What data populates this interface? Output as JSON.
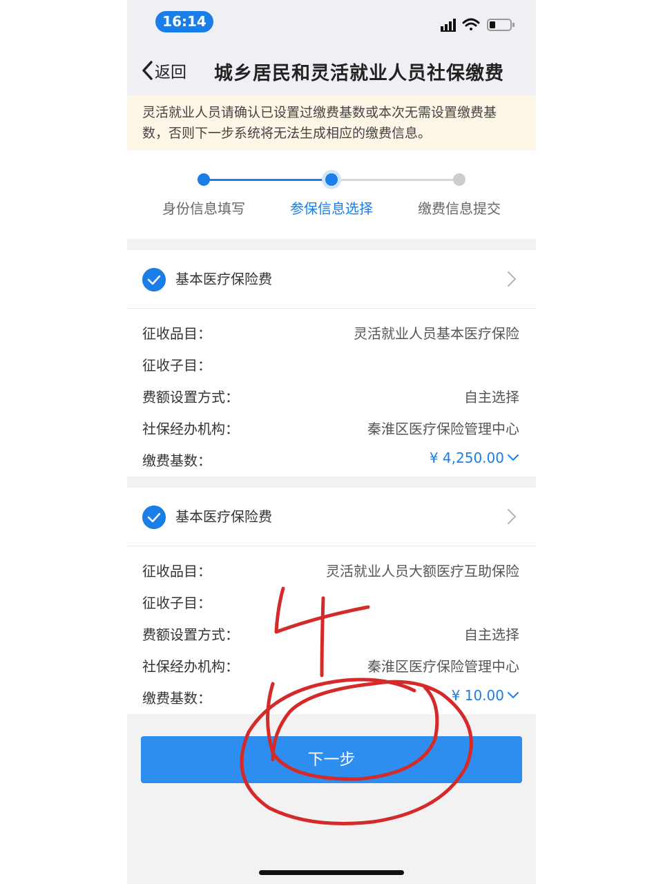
{
  "status_bar": {
    "time": "16:14"
  },
  "nav": {
    "back_label": "返回",
    "title": "城乡居民和灵活就业人员社保缴费"
  },
  "notice": {
    "text": "灵活就业人员请确认已设置过缴费基数或本次无需设置缴费基数，否则下一步系统将无法生成相应的缴费信息。"
  },
  "steps": [
    {
      "label": "身份信息填写",
      "state": "done"
    },
    {
      "label": "参保信息选择",
      "state": "active"
    },
    {
      "label": "缴费信息提交",
      "state": "pending"
    }
  ],
  "cards": [
    {
      "title": "基本医疗保险费",
      "rows": [
        {
          "label": "征收品目：",
          "value": "灵活就业人员基本医疗保险"
        },
        {
          "label": "征收子目：",
          "value": ""
        },
        {
          "label": "费额设置方式：",
          "value": "自主选择"
        },
        {
          "label": "社保经办机构：",
          "value": "秦淮区医疗保险管理中心"
        },
        {
          "label": "缴费基数：",
          "value": "¥ 4,250.00"
        }
      ]
    },
    {
      "title": "基本医疗保险费",
      "rows": [
        {
          "label": "征收品目：",
          "value": "灵活就业人员大额医疗互助保险"
        },
        {
          "label": "征收子目：",
          "value": ""
        },
        {
          "label": "费额设置方式：",
          "value": "自主选择"
        },
        {
          "label": "社保经办机构：",
          "value": "秦淮区医疗保险管理中心"
        },
        {
          "label": "缴费基数：",
          "value": "¥ 10.00"
        }
      ]
    }
  ],
  "next_button": {
    "label": "下一步"
  },
  "colors": {
    "accent": "#1a7ee6",
    "button": "#2e8ef0",
    "annotation": "#d42a2a",
    "notice_bg": "#fdf6e6"
  }
}
